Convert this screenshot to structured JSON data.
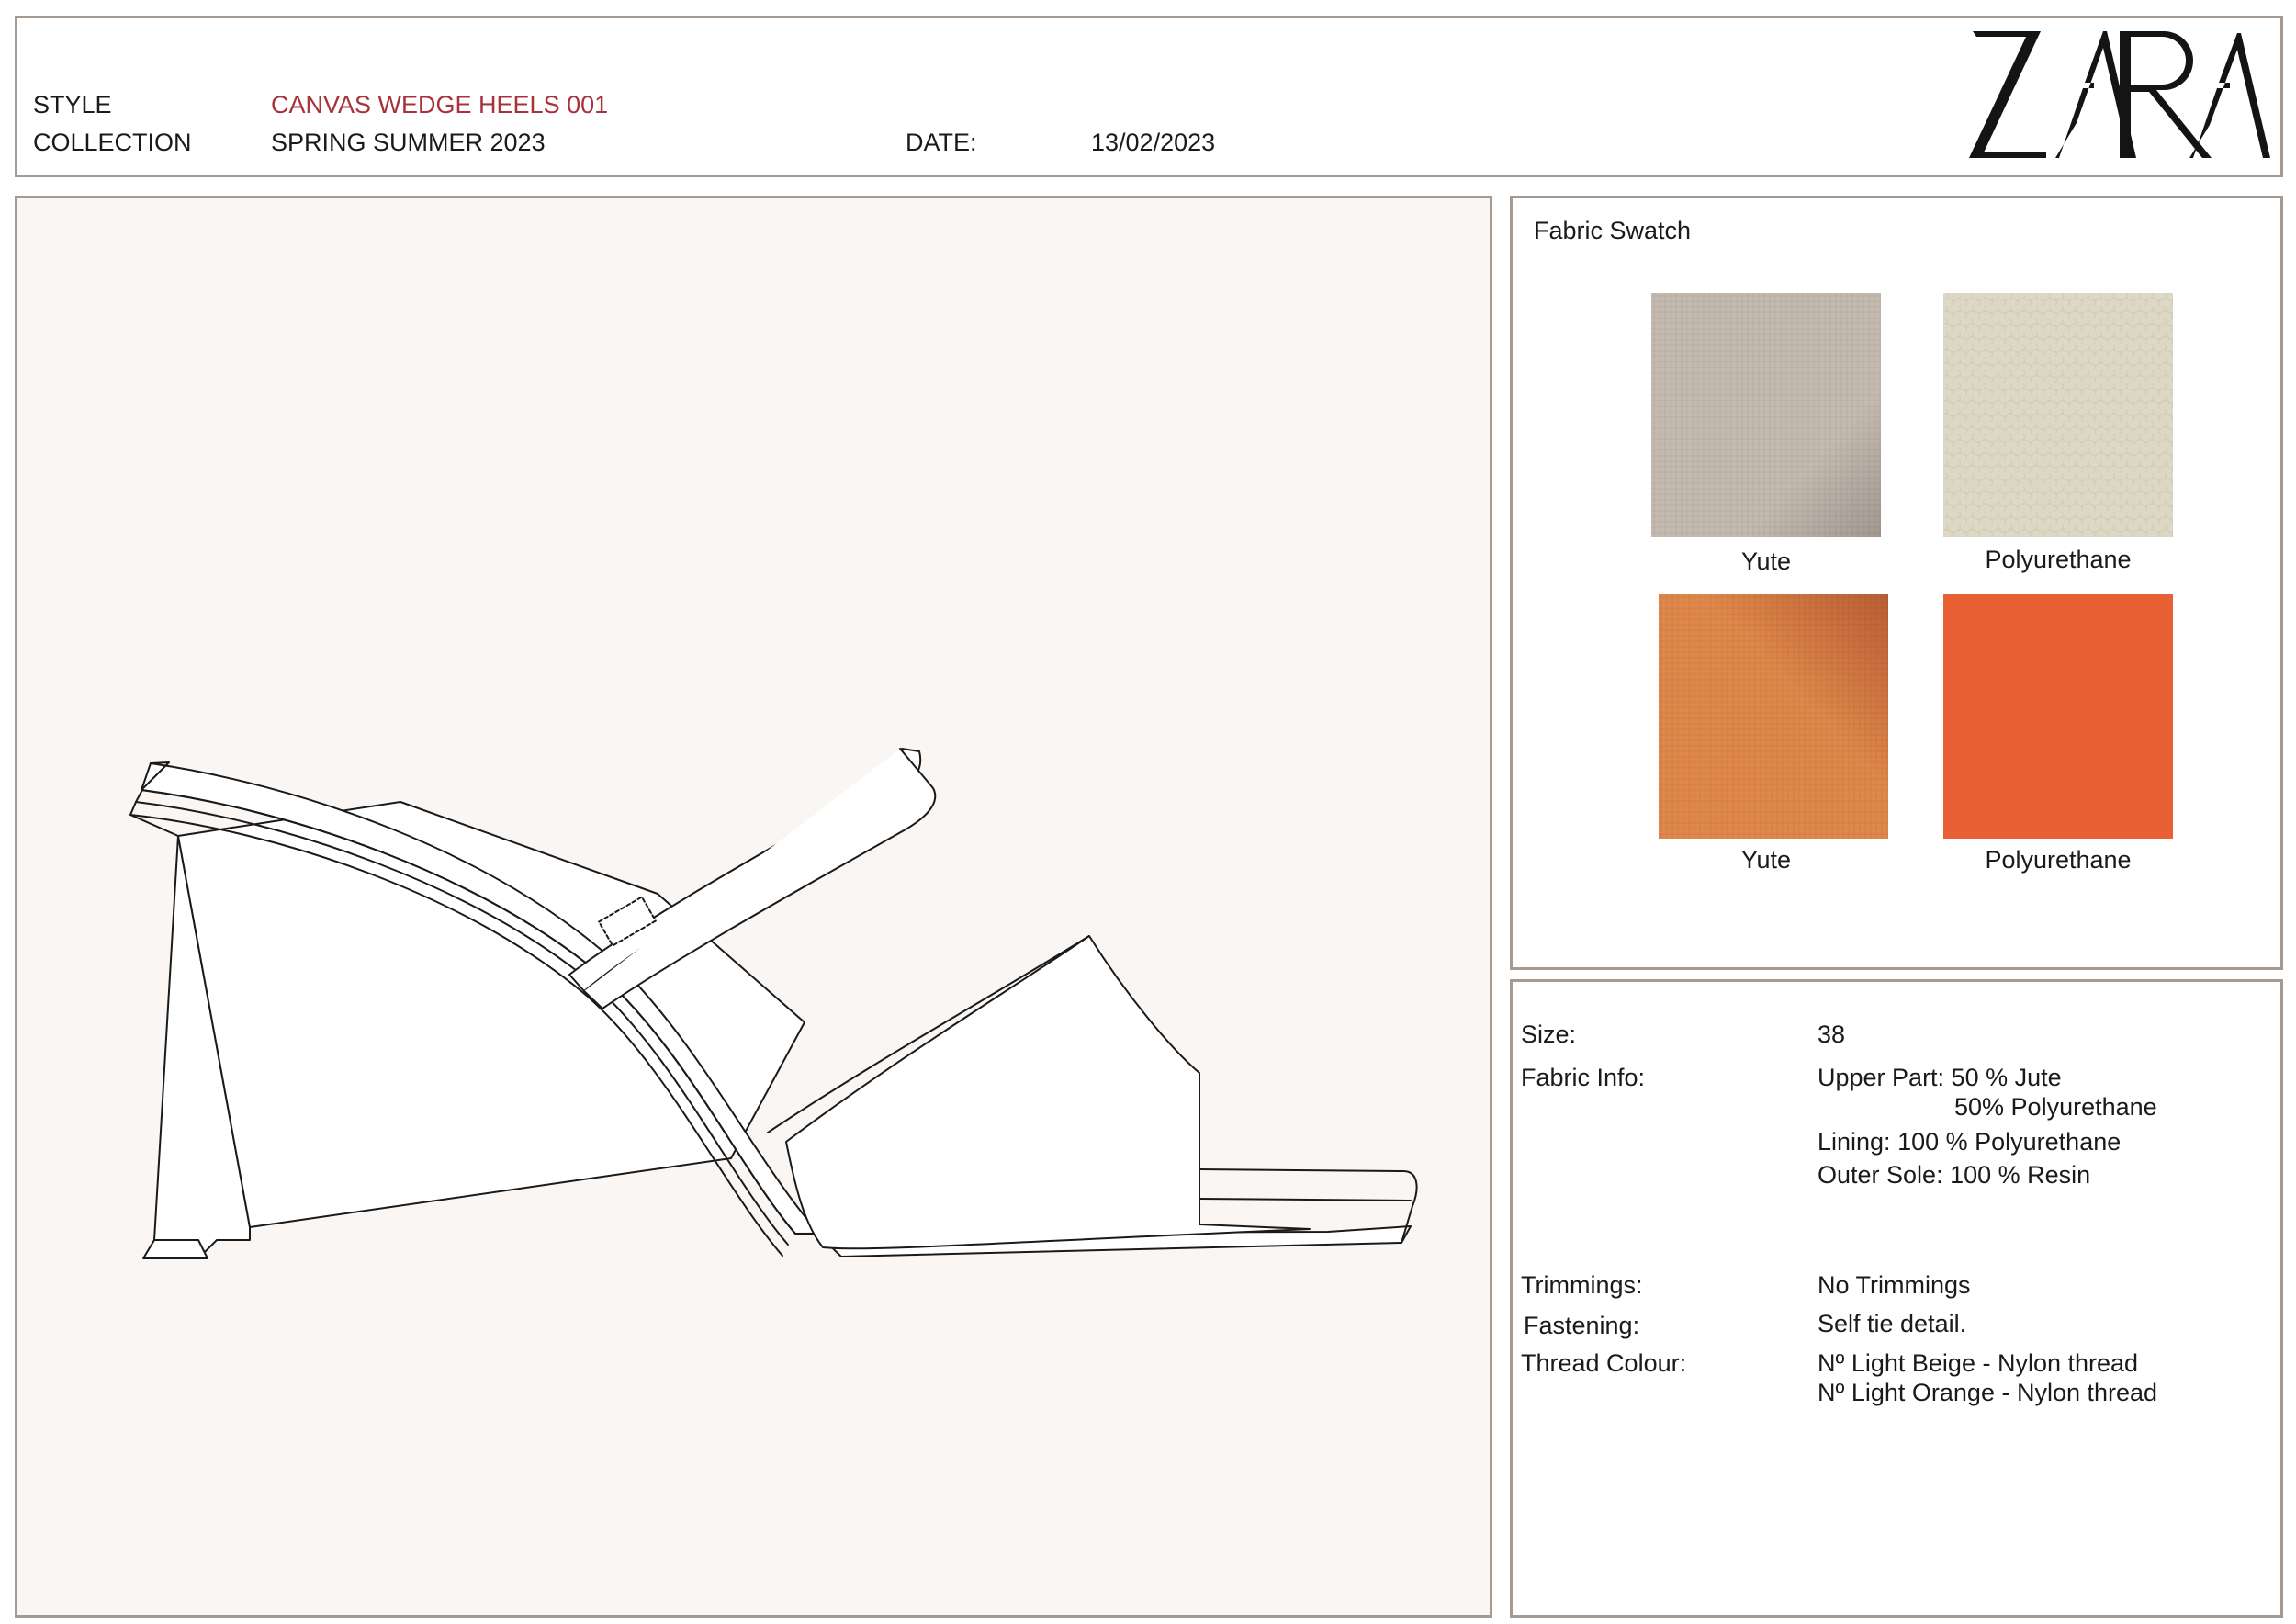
{
  "header": {
    "style_label": "STYLE",
    "style_value": "CANVAS WEDGE HEELS 001",
    "collection_label": "COLLECTION",
    "collection_value": "SPRING SUMMER 2023",
    "date_label": "DATE:",
    "date_value": "13/02/2023",
    "brand": "ZARA"
  },
  "swatches": {
    "title": "Fabric Swatch",
    "items": [
      {
        "label": "Yute",
        "color": "#c5bab0",
        "texture": "woven"
      },
      {
        "label": "Polyurethane",
        "color": "#ddd8c4",
        "texture": "leather"
      },
      {
        "label": "Yute",
        "color": "#e0884a",
        "texture": "woven"
      },
      {
        "label": "Polyurethane",
        "color": "#e86034",
        "texture": "solid"
      }
    ]
  },
  "specs": {
    "size_label": "Size:",
    "size_value": "38",
    "fabric_label": "Fabric Info:",
    "fabric_lines": [
      "Upper Part: 50 % Jute",
      "50% Polyurethane",
      "Lining: 100 % Polyurethane",
      "Outer Sole: 100 % Resin"
    ],
    "trimmings_label": "Trimmings:",
    "trimmings_value": "No Trimmings",
    "fastening_label": "Fastening:",
    "fastening_value": "Self tie detail.",
    "thread_label": "Thread Colour:",
    "thread_lines": [
      "Nº Light Beige - Nylon thread",
      "Nº Light Orange - Nylon thread"
    ]
  },
  "colors": {
    "border": "#a59a91",
    "drawing_bg": "#f9f6f3",
    "style_accent": "#a8323c"
  }
}
